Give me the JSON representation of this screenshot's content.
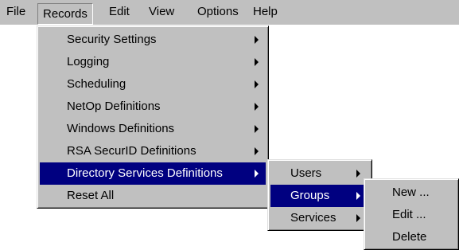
{
  "menubar": {
    "file": "File",
    "records": "Records",
    "edit": "Edit",
    "view": "View",
    "options": "Options",
    "help": "Help"
  },
  "records_menu": {
    "items": [
      {
        "label": "Security Settings",
        "has_submenu": true
      },
      {
        "label": "Logging",
        "has_submenu": true
      },
      {
        "label": "Scheduling",
        "has_submenu": true
      },
      {
        "label": "NetOp Definitions",
        "has_submenu": true
      },
      {
        "label": "Windows Definitions",
        "has_submenu": true
      },
      {
        "label": "RSA SecurID Definitions",
        "has_submenu": true
      },
      {
        "label": "Directory Services Definitions",
        "has_submenu": true,
        "highlighted": true
      },
      {
        "label": "Reset All",
        "has_submenu": false
      }
    ]
  },
  "directory_submenu": {
    "items": [
      {
        "label": "Users",
        "has_submenu": true
      },
      {
        "label": "Groups",
        "has_submenu": true,
        "highlighted": true
      },
      {
        "label": "Services",
        "has_submenu": true
      }
    ]
  },
  "groups_submenu": {
    "items": [
      {
        "label": "New ..."
      },
      {
        "label": "Edit ..."
      },
      {
        "label": "Delete"
      }
    ]
  },
  "colors": {
    "menu_background": "#c0c0c0",
    "highlight": "#000080",
    "highlight_text": "#ffffff"
  }
}
